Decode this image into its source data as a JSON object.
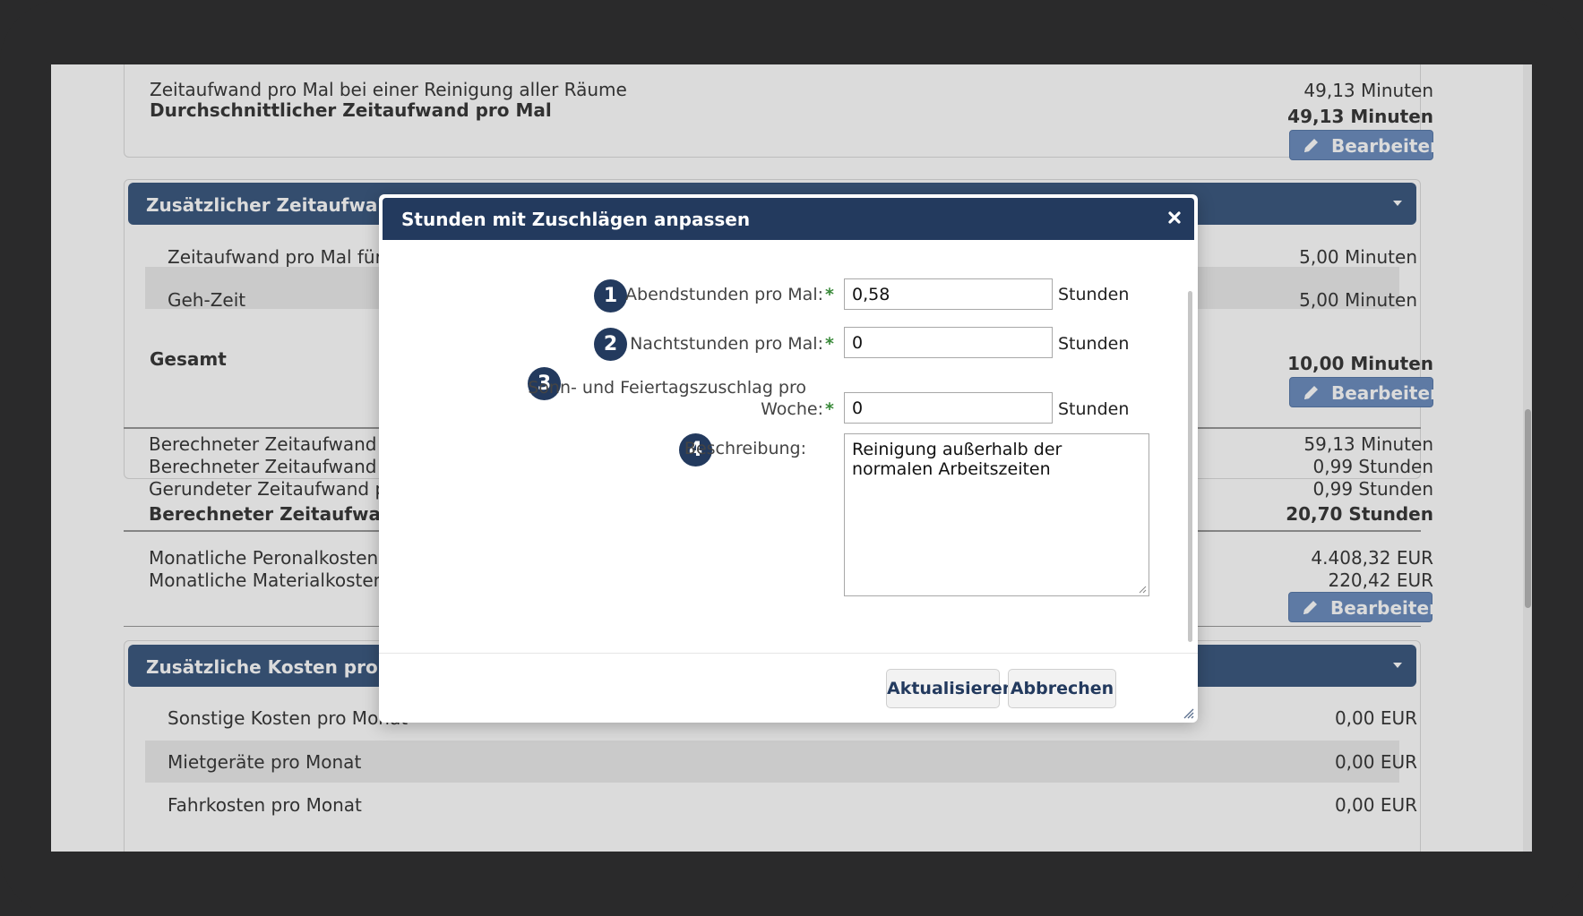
{
  "top_card": {
    "rows": [
      {
        "label": "Zeitaufwand pro Mal bei einer Reinigung aller Räume",
        "value": "49,13 Minuten"
      },
      {
        "label": "Durchschnittlicher Zeitaufwand pro Mal",
        "value": "49,13 Minuten"
      }
    ],
    "edit_label": "Bearbeiten"
  },
  "section_time": {
    "title": "Zusätzlicher Zeitaufwand pr",
    "rows": [
      {
        "label": "Zeitaufwand pro Mal für zu",
        "value": "5,00 Minuten"
      },
      {
        "label": "Geh-Zeit",
        "value": "5,00 Minuten"
      }
    ],
    "total_label": "Gesamt",
    "total_value": "10,00 Minuten",
    "edit_label": "Bearbeiten"
  },
  "calc": {
    "rows": [
      {
        "label": "Berechneter Zeitaufwand pro",
        "value": "59,13 Minuten"
      },
      {
        "label": "Berechneter Zeitaufwand pro",
        "value": "0,99 Stunden"
      },
      {
        "label": "Gerundeter Zeitaufwand pro",
        "value": "0,99 Stunden"
      },
      {
        "label": "Berechneter Zeitaufwand pr",
        "value": "20,70 Stunden"
      }
    ]
  },
  "costs": {
    "rows": [
      {
        "label": "Monatliche Peronalkosten",
        "value": "4.408,32 EUR"
      },
      {
        "label": "Monatliche Materialkosten",
        "value": "220,42 EUR"
      }
    ],
    "edit_label": "Bearbeiten"
  },
  "section_costs": {
    "title": "Zusätzliche Kosten pro Mona",
    "rows": [
      {
        "label": "Sonstige Kosten pro Monat",
        "value": "0,00 EUR"
      },
      {
        "label": "Mietgeräte pro Monat",
        "value": "0,00 EUR"
      },
      {
        "label": "Fahrkosten pro Monat",
        "value": "0,00 EUR"
      }
    ]
  },
  "dialog": {
    "title": "Stunden mit Zuschlägen anpassen",
    "close_icon": "close-icon",
    "fields": [
      {
        "num": "1",
        "label": "Abendstunden pro Mal:",
        "required": "*",
        "value": "0,58",
        "unit": "Stunden"
      },
      {
        "num": "2",
        "label": "Nachtstunden pro Mal:",
        "required": "*",
        "value": "0",
        "unit": "Stunden"
      },
      {
        "num": "3",
        "label_line1": "Sonn- und Feiertagszuschlag pro",
        "label_line2": "Woche:",
        "required": "*",
        "value": "0",
        "unit": "Stunden"
      }
    ],
    "description": {
      "num": "4",
      "label": "Beschreibung:",
      "value": "Reinigung außerhalb der normalen Arbeitszeiten"
    },
    "update_label": "Aktualisieren",
    "cancel_label": "Abbrechen"
  },
  "colors": {
    "header": "#233a5e",
    "section": "#3d5a80",
    "edit_button": "#6e8fbf",
    "required": "#3a8a3a"
  }
}
